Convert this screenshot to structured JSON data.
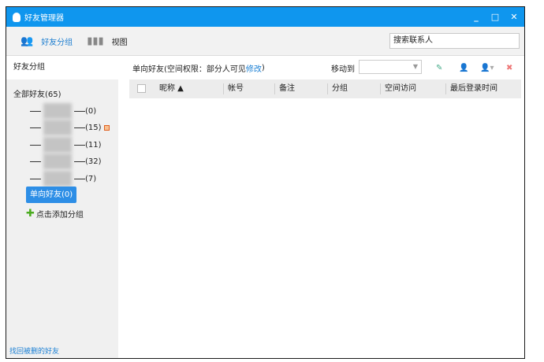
{
  "window": {
    "title": "好友管理器",
    "minimize": "_",
    "maximize": "□",
    "close": "✕"
  },
  "toolbar": {
    "groups_label": "好友分组",
    "view_label": "视图",
    "search_placeholder": "搜索联系人"
  },
  "sidebar": {
    "header": "好友分组",
    "all_friends": "全部好友(65)",
    "groups": [
      {
        "count": "(0)"
      },
      {
        "count": "(15)"
      },
      {
        "count": "(11)"
      },
      {
        "count": "(32)"
      },
      {
        "count": "(7)"
      }
    ],
    "selected": "单向好友(0)",
    "add_group": "点击添加分组",
    "recover_link": "找回被删的好友"
  },
  "main": {
    "heading_prefix": "单向好友(空间权限：部分人可见",
    "heading_link": "修改",
    "heading_suffix": ")",
    "move_to": "移动到",
    "columns": [
      "昵称 ▲",
      "帐号",
      "备注",
      "分组",
      "空间访问",
      "最后登录时间"
    ]
  },
  "colors": {
    "title_bar": "#0f96ee",
    "selected": "#2d8ee6"
  }
}
